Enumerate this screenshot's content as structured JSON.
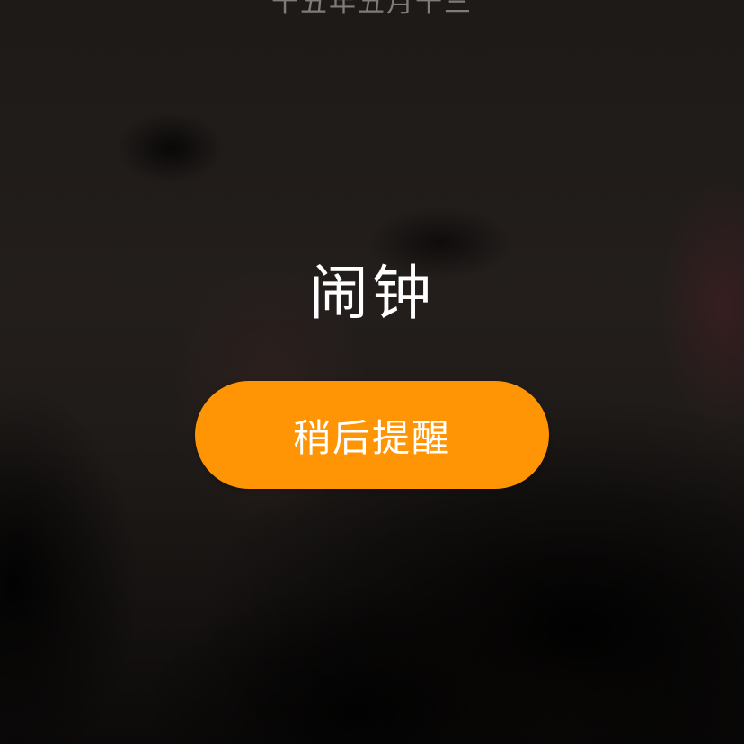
{
  "top_text": "十五年五月十三",
  "alarm": {
    "title": "闹钟",
    "snooze_label": "稍后提醒"
  },
  "colors": {
    "accent": "#ff9504",
    "text": "#ffffff"
  }
}
